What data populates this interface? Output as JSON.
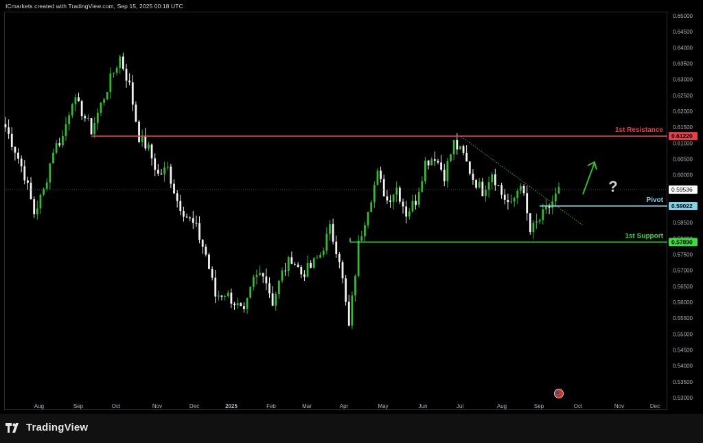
{
  "header": {
    "text": "ICmarkets created with TradingView.com, Sep 15, 2025 00:18 UTC"
  },
  "brand": {
    "name": "TradingView",
    "logo_icon": "tradingview-logo-icon"
  },
  "colors": {
    "background": "#000000",
    "up": "#2ebd2e",
    "down": "#f2f2f2",
    "resistance": "#e5404a",
    "pivot": "#7fd3e6",
    "support": "#3ddc3d",
    "axis_text": "#b2b5be"
  },
  "chart_data": {
    "type": "candlestick",
    "y_axis": {
      "range": [
        0.53,
        0.65
      ],
      "ticks": [
        "0.65000",
        "0.64500",
        "0.64000",
        "0.63500",
        "0.63000",
        "0.62500",
        "0.62000",
        "0.61500",
        "0.61000",
        "0.60500",
        "0.60000",
        "0.59500",
        "0.59000",
        "0.58500",
        "0.58000",
        "0.57500",
        "0.57000",
        "0.56500",
        "0.56000",
        "0.55500",
        "0.55000",
        "0.54500",
        "0.54000",
        "0.53500",
        "0.53000"
      ]
    },
    "x_axis": {
      "ticks": [
        "Aug",
        "Sep",
        "Oct",
        "Nov",
        "Dec",
        "2025",
        "Feb",
        "Mar",
        "Apr",
        "May",
        "Jun",
        "Jul",
        "Aug",
        "Sep",
        "Oct",
        "Nov",
        "Dec"
      ]
    },
    "levels": [
      {
        "name": "1st Resistance",
        "value": 0.6122,
        "label": "0.61220",
        "color": "#e5404a"
      },
      {
        "name": "Pivot",
        "value": 0.59022,
        "label": "0.59022",
        "color": "#7fd3e6"
      },
      {
        "name": "1st Support",
        "value": 0.5789,
        "label": "0.57890",
        "color": "#3ddc3d"
      }
    ],
    "current_price": {
      "value": 0.59536,
      "label": "0.59536"
    },
    "trendline": {
      "from": {
        "x": "Jul",
        "y": 0.612
      },
      "to": {
        "x": "Oct",
        "y": 0.584
      },
      "style": "dotted"
    },
    "annotation": {
      "arrow": "up",
      "symbol": "?"
    },
    "path": [
      {
        "t": "Jul",
        "y": 0.615
      },
      {
        "t": "Jul",
        "y": 0.608
      },
      {
        "t": "Jul",
        "y": 0.6
      },
      {
        "t": "Aug",
        "y": 0.588
      },
      {
        "t": "Aug",
        "y": 0.595
      },
      {
        "t": "Aug",
        "y": 0.608
      },
      {
        "t": "Aug",
        "y": 0.612
      },
      {
        "t": "Sep",
        "y": 0.624
      },
      {
        "t": "Sep",
        "y": 0.62
      },
      {
        "t": "Sep",
        "y": 0.614
      },
      {
        "t": "Sep",
        "y": 0.622
      },
      {
        "t": "Sep",
        "y": 0.63
      },
      {
        "t": "Oct",
        "y": 0.637
      },
      {
        "t": "Oct",
        "y": 0.628
      },
      {
        "t": "Oct",
        "y": 0.612
      },
      {
        "t": "Oct",
        "y": 0.608
      },
      {
        "t": "Nov",
        "y": 0.6
      },
      {
        "t": "Nov",
        "y": 0.602
      },
      {
        "t": "Nov",
        "y": 0.592
      },
      {
        "t": "Nov",
        "y": 0.587
      },
      {
        "t": "Dec",
        "y": 0.583
      },
      {
        "t": "Dec",
        "y": 0.575
      },
      {
        "t": "Dec",
        "y": 0.562
      },
      {
        "t": "Dec",
        "y": 0.563
      },
      {
        "t": "2025",
        "y": 0.56
      },
      {
        "t": "2025",
        "y": 0.556
      },
      {
        "t": "2025",
        "y": 0.567
      },
      {
        "t": "Feb",
        "y": 0.57
      },
      {
        "t": "Feb",
        "y": 0.56
      },
      {
        "t": "Feb",
        "y": 0.569
      },
      {
        "t": "Feb",
        "y": 0.574
      },
      {
        "t": "Mar",
        "y": 0.569
      },
      {
        "t": "Mar",
        "y": 0.571
      },
      {
        "t": "Mar",
        "y": 0.575
      },
      {
        "t": "Mar",
        "y": 0.583
      },
      {
        "t": "Apr",
        "y": 0.574
      },
      {
        "t": "Apr",
        "y": 0.552
      },
      {
        "t": "Apr",
        "y": 0.578
      },
      {
        "t": "Apr",
        "y": 0.59
      },
      {
        "t": "May",
        "y": 0.6
      },
      {
        "t": "May",
        "y": 0.592
      },
      {
        "t": "May",
        "y": 0.596
      },
      {
        "t": "May",
        "y": 0.588
      },
      {
        "t": "Jun",
        "y": 0.592
      },
      {
        "t": "Jun",
        "y": 0.604
      },
      {
        "t": "Jun",
        "y": 0.606
      },
      {
        "t": "Jun",
        "y": 0.6
      },
      {
        "t": "Jul",
        "y": 0.61
      },
      {
        "t": "Jul",
        "y": 0.606
      },
      {
        "t": "Jul",
        "y": 0.599
      },
      {
        "t": "Jul",
        "y": 0.595
      },
      {
        "t": "Aug",
        "y": 0.601
      },
      {
        "t": "Aug",
        "y": 0.594
      },
      {
        "t": "Aug",
        "y": 0.59
      },
      {
        "t": "Aug",
        "y": 0.598
      },
      {
        "t": "Sep",
        "y": 0.582
      },
      {
        "t": "Sep",
        "y": 0.586
      },
      {
        "t": "Sep",
        "y": 0.59
      },
      {
        "t": "Sep",
        "y": 0.595
      }
    ]
  }
}
